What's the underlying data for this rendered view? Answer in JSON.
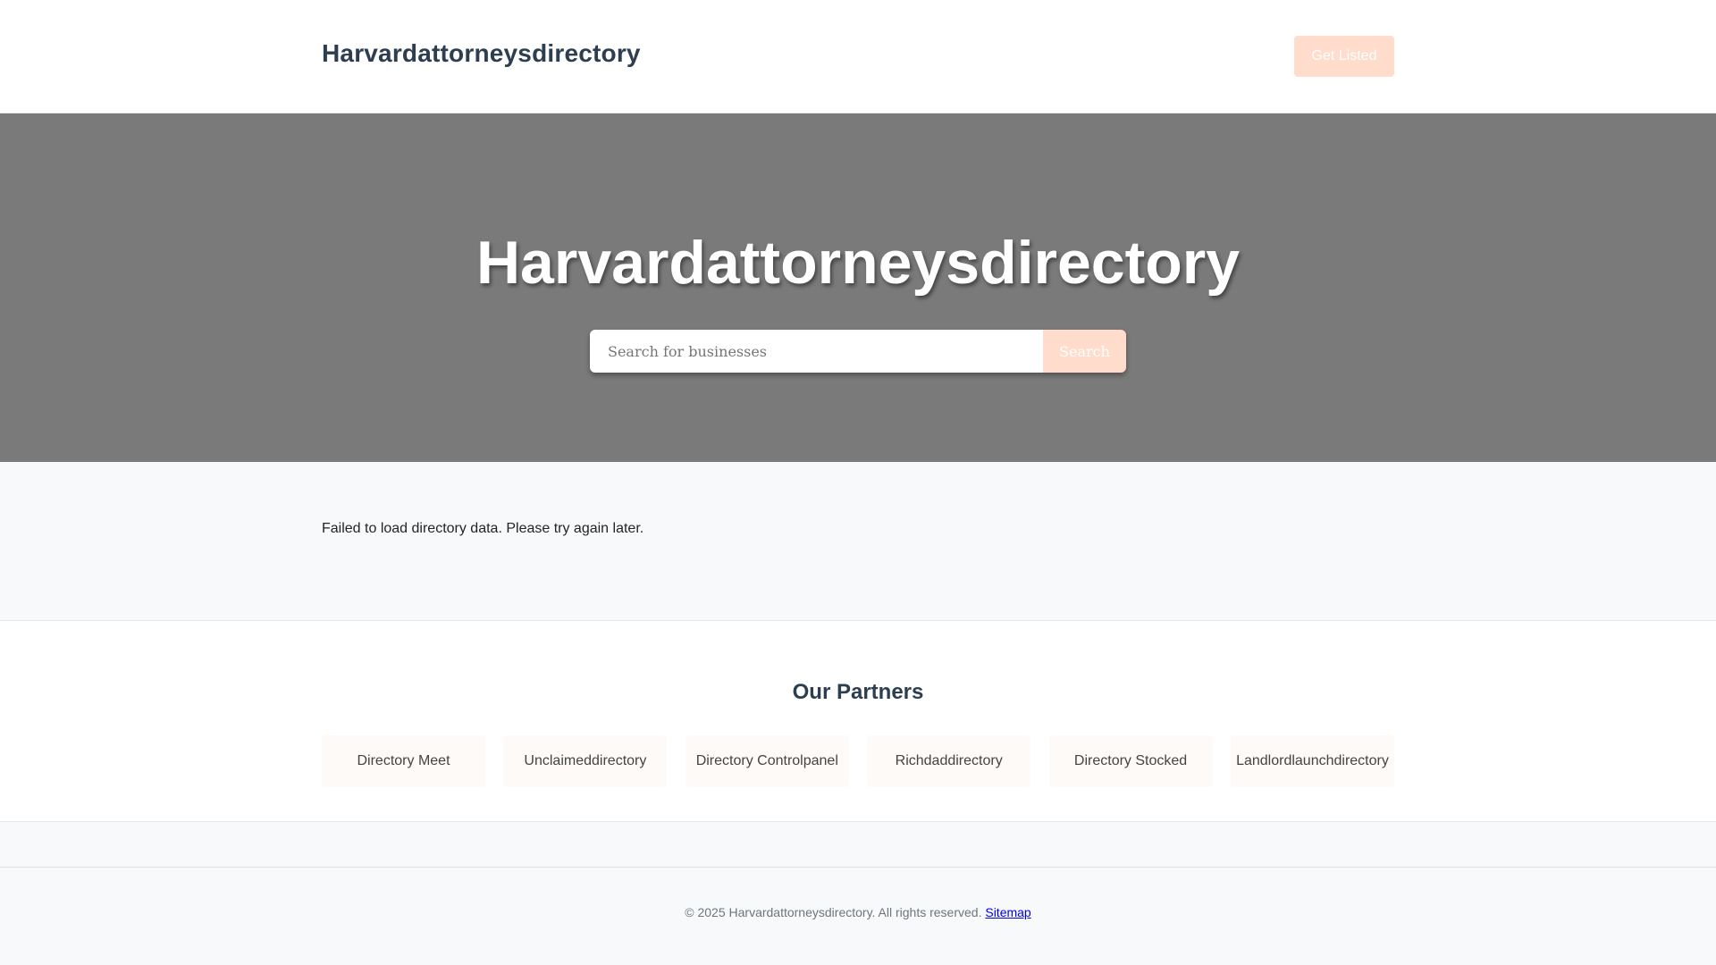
{
  "header": {
    "brand": "Harvardattorneysdirectory",
    "cta_label": "Get Listed"
  },
  "hero": {
    "title": "Harvardattorneysdirectory",
    "search": {
      "placeholder": "Search for businesses",
      "value": "",
      "button_label": "Search"
    }
  },
  "listing": {
    "status_message": "Failed to load directory data. Please try again later."
  },
  "partners": {
    "heading": "Our Partners",
    "items": [
      {
        "label": "Directory Meet"
      },
      {
        "label": "Unclaimeddirectory"
      },
      {
        "label": "Directory Controlpanel"
      },
      {
        "label": "Richdaddirectory"
      },
      {
        "label": "Directory Stocked"
      },
      {
        "label": "Landlordlaunchdirectory"
      }
    ]
  },
  "footer": {
    "copyright": "© 2025 Harvardattorneysdirectory. All rights reserved.",
    "sitemap_label": "Sitemap"
  },
  "colors": {
    "brand_text": "#2c3e50",
    "accent": "#ffdccb",
    "hero_bg": "#7a7a7a",
    "link": "#0000ee"
  }
}
